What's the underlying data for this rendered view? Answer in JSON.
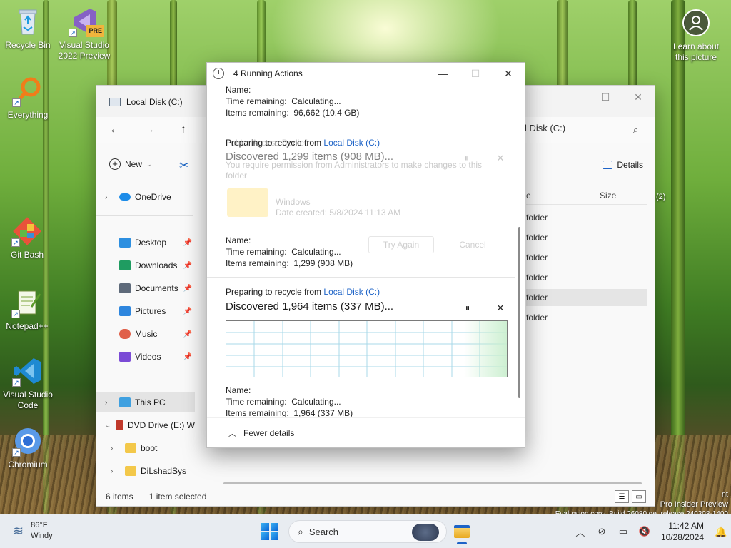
{
  "desktop": {
    "icons": [
      {
        "label": "Recycle Bin",
        "icon": "recycle-bin-icon"
      },
      {
        "label": "Visual Studio 2022 Preview",
        "icon": "visual-studio-preview-icon",
        "badge": "PRE"
      },
      {
        "label": "Everything",
        "icon": "everything-search-icon"
      },
      {
        "label": "Git Bash",
        "icon": "git-bash-icon"
      },
      {
        "label": "Notepad++",
        "icon": "notepad-plus-plus-icon"
      },
      {
        "label": "Visual Studio Code",
        "icon": "vscode-icon"
      },
      {
        "label": "Chromium",
        "icon": "chromium-icon"
      }
    ],
    "learn": {
      "label": "Learn about this picture",
      "icon": "learn-about-picture-icon"
    }
  },
  "explorer": {
    "tab_title": "Local Disk (C:)",
    "address_fragment": "l Disk (C:)",
    "new_label": "New",
    "details_label": "Details",
    "nav": [
      {
        "label": "OneDrive",
        "chevron": true,
        "pinned": false,
        "color": "#1d8ce8"
      },
      {
        "label": "Desktop",
        "chevron": false,
        "pinned": true,
        "color": "#2d8fe0"
      },
      {
        "label": "Downloads",
        "chevron": false,
        "pinned": true,
        "color": "#1f9c61"
      },
      {
        "label": "Documents",
        "chevron": false,
        "pinned": true,
        "color": "#5e6a7a"
      },
      {
        "label": "Pictures",
        "chevron": false,
        "pinned": true,
        "color": "#2e86de"
      },
      {
        "label": "Music",
        "chevron": false,
        "pinned": true,
        "color": "#e0604a"
      },
      {
        "label": "Videos",
        "chevron": false,
        "pinned": true,
        "color": "#7b4bd6"
      },
      {
        "label": "This PC",
        "chevron": true,
        "pinned": false,
        "color": "#3fa0e0"
      },
      {
        "label": "DVD Drive (E:) W",
        "chevron": true,
        "pinned": false,
        "color": "#c0392b"
      },
      {
        "label": "boot",
        "chevron": true,
        "pinned": false,
        "color": "#f3c84a"
      },
      {
        "label": "DiLshadSys",
        "chevron": true,
        "pinned": false,
        "color": "#f3c84a"
      }
    ],
    "columns": {
      "name": "e",
      "size": "Size"
    },
    "rows": [
      "folder",
      "folder",
      "folder",
      "folder",
      "folder",
      "folder"
    ],
    "side_badge": "(2)",
    "status": {
      "items": "6 items",
      "selected": "1 item selected"
    }
  },
  "watermark": {
    "line1": "nt",
    "line2": "Pro Insider Preview",
    "line3": "Evaluation copy. Build 26080.ge_release.240308-1400"
  },
  "dialog": {
    "title": "4 Running Actions",
    "labels": {
      "name": "Name:",
      "time": "Time remaining:",
      "items": "Items remaining:",
      "preparing": "Preparing to recycle from"
    },
    "op1": {
      "time": "Calculating...",
      "items": "96,662 (10.4 GB)"
    },
    "op2": {
      "source": "Local Disk (C:)",
      "discovered": "Discovered 1,299 items (908 MB)...",
      "ghost_title": "Folder Access Denied",
      "ghost_msg": "You require permission from Administrators to make changes to this folder",
      "ghost_folder": "Windows",
      "ghost_date": "Date created: 5/8/2024 11:13 AM",
      "try_again": "Try Again",
      "cancel": "Cancel",
      "time": "Calculating...",
      "items": "1,299 (908 MB)"
    },
    "op3": {
      "source": "Local Disk (C:)",
      "discovered": "Discovered 1,964 items (337 MB)...",
      "time": "Calculating...",
      "items": "1,964 (337 MB)"
    },
    "footer": "Fewer details"
  },
  "taskbar": {
    "weather_temp": "86°F",
    "weather_desc": "Windy",
    "search_placeholder": "Search",
    "time": "11:42 AM",
    "date": "10/28/2024"
  }
}
